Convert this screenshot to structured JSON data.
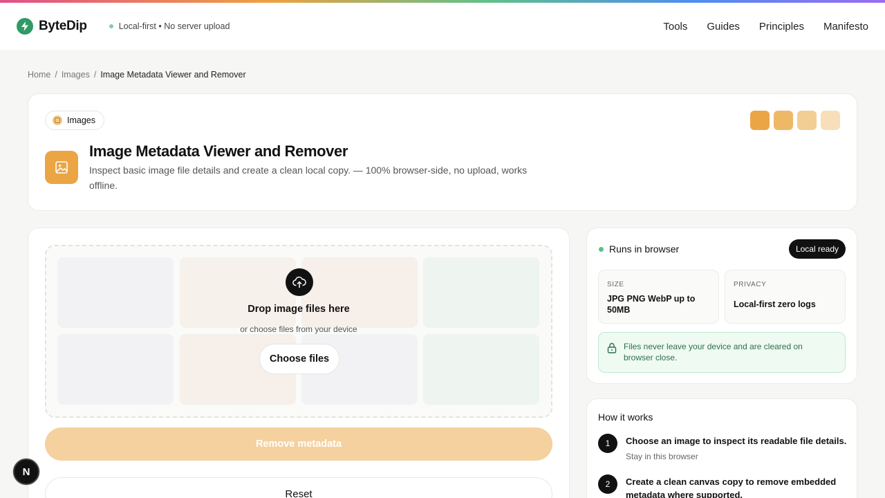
{
  "header": {
    "brand": "ByteDip",
    "status": "Local-first • No server upload",
    "nav": [
      "Tools",
      "Guides",
      "Principles",
      "Manifesto"
    ]
  },
  "breadcrumb": {
    "home": "Home",
    "section": "Images",
    "current": "Image Metadata Viewer and Remover",
    "separator": "/"
  },
  "hero": {
    "category": "Images",
    "title": "Image Metadata Viewer and Remover",
    "description": "Inspect basic image file details and create a clean local copy. — 100% browser-side, no upload, works offline.",
    "swatches": [
      "#eba545",
      "#efb867",
      "#f2cd94",
      "#f8dfba"
    ]
  },
  "tool": {
    "drop_title": "Drop image files here",
    "drop_sub": "or choose files from your device",
    "choose_label": "Choose files",
    "remove_label": "Remove metadata",
    "reset_label": "Reset"
  },
  "status_card": {
    "run_label": "Runs in browser",
    "ready_label": "Local ready",
    "size_label": "SIZE",
    "size_value": "JPG PNG WebP up to 50MB",
    "privacy_label": "PRIVACY",
    "privacy_value": "Local-first zero logs",
    "notice": "Files never leave your device and are cleared on browser close."
  },
  "how": {
    "title": "How it works",
    "steps": [
      {
        "num": "1",
        "text": "Choose an image to inspect its readable file details.",
        "sub": "Stay in this browser"
      },
      {
        "num": "2",
        "text": "Create a clean canvas copy to remove embedded metadata where supported."
      }
    ]
  },
  "fab_label": "N",
  "colors": {
    "accent": "#eba545",
    "brand": "#2f9a66"
  }
}
